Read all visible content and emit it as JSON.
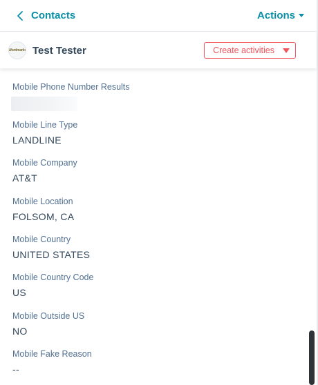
{
  "nav": {
    "back_label": "Contacts",
    "actions_label": "Actions"
  },
  "record": {
    "avatar_text": "Wordmarks",
    "name": "Test Tester",
    "create_activities_label": "Create activities"
  },
  "properties": [
    {
      "label": "Mobile Phone Number Results",
      "value": ""
    },
    {
      "label": "Mobile Line Type",
      "value": "LANDLINE"
    },
    {
      "label": "Mobile Company",
      "value": "AT&T"
    },
    {
      "label": "Mobile Location",
      "value": "FOLSOM, CA"
    },
    {
      "label": "Mobile Country",
      "value": "UNITED STATES"
    },
    {
      "label": "Mobile Country Code",
      "value": "US"
    },
    {
      "label": "Mobile Outside US",
      "value": "NO"
    },
    {
      "label": "Mobile Fake Reason",
      "value": "--"
    }
  ],
  "icons": {
    "back": "chevron-left-icon",
    "actions": "caret-down-icon",
    "create": "triangle-down-icon"
  },
  "colors": {
    "link": "#0b8fa8",
    "accent": "#f2545b",
    "text": "#33475b",
    "label": "#516f90"
  }
}
